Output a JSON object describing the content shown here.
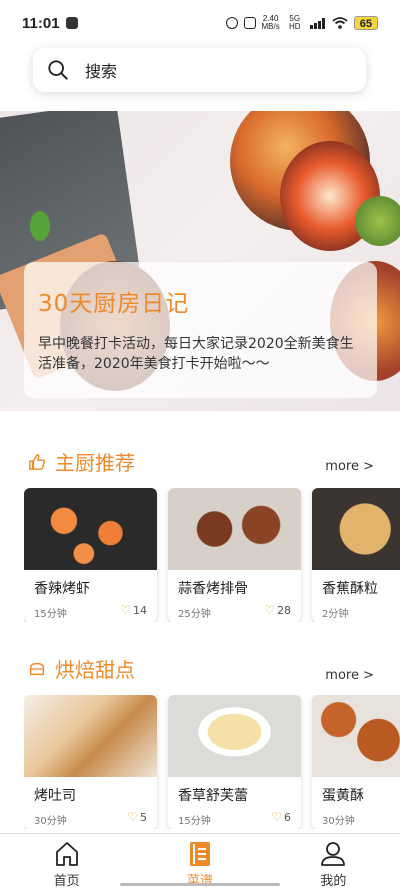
{
  "status": {
    "time": "11:01",
    "net_speed": "2.40",
    "net_unit": "MB/s",
    "net_type": "5G HD",
    "battery": "65"
  },
  "search": {
    "placeholder": "搜索"
  },
  "banner": {
    "title": "30天厨房日记",
    "description": "早中晚餐打卡活动，每日大家记录2020全新美食生活准备，2020年美食打卡开始啦～～"
  },
  "sections": [
    {
      "title": "主厨推荐",
      "icon": "thumbs-up-icon",
      "more": "more >",
      "cards": [
        {
          "name": "香辣烤虾",
          "time": "15分钟",
          "likes": "14"
        },
        {
          "name": "蒜香烤排骨",
          "time": "25分钟",
          "likes": "28"
        },
        {
          "name": "香蕉酥粒",
          "time": "2分钟",
          "likes": ""
        }
      ]
    },
    {
      "title": "烘焙甜点",
      "icon": "bread-icon",
      "more": "more >",
      "cards": [
        {
          "name": "烤吐司",
          "time": "30分钟",
          "likes": "5"
        },
        {
          "name": "香草舒芙蕾",
          "time": "15分钟",
          "likes": "6"
        },
        {
          "name": "蛋黄酥",
          "time": "30分钟",
          "likes": ""
        }
      ]
    }
  ],
  "tabs": [
    {
      "label": "首页",
      "icon": "home-icon",
      "active": false
    },
    {
      "label": "菜谱",
      "icon": "recipe-book-icon",
      "active": true
    },
    {
      "label": "我的",
      "icon": "user-icon",
      "active": false
    }
  ],
  "colors": {
    "accent": "#ee8a2a",
    "battery": "#f5d53c"
  }
}
